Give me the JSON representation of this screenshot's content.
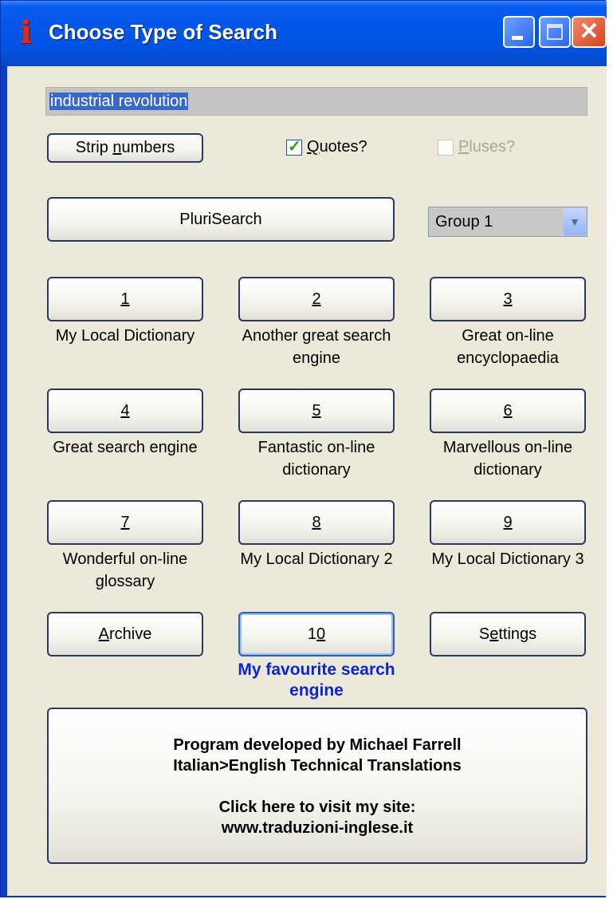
{
  "window": {
    "title": "Choose Type of Search",
    "icon": "i",
    "controls": {
      "minimize": "minimize-icon",
      "maximize": "maximize-icon",
      "close": "close-icon"
    }
  },
  "search": {
    "value": "industrial revolution"
  },
  "options": {
    "strip_label": "Strip numbers",
    "quotes_label": "Quotes?",
    "quotes_checked": true,
    "pluses_label": "Pluses?",
    "pluses_checked": false,
    "pluses_enabled": false
  },
  "plurisearch_label": "PluriSearch",
  "group_select": {
    "value": "Group 1"
  },
  "engines": [
    {
      "num": "1",
      "label": "My Local Dictionary"
    },
    {
      "num": "2",
      "label": "Another great search engine"
    },
    {
      "num": "3",
      "label": "Great on-line encyclopaedia"
    },
    {
      "num": "4",
      "label": "Great search engine"
    },
    {
      "num": "5",
      "label": "Fantastic on-line dictionary"
    },
    {
      "num": "6",
      "label": "Marvellous on-line dictionary"
    },
    {
      "num": "7",
      "label": "Wonderful on-line glossary"
    },
    {
      "num": "8",
      "label": "My Local Dictionary 2"
    },
    {
      "num": "9",
      "label": "My Local Dictionary 3"
    }
  ],
  "bottom_row": {
    "archive_label": "Archive",
    "ten_label": "10",
    "settings_label": "Settings",
    "favourite_label": "My favourite search engine"
  },
  "info": {
    "line1": "Program developed by Michael Farrell",
    "line2": "Italian>English Technical Translations",
    "line3": "Click here to visit my site:",
    "line4": "www.traduzioni-inglese.it"
  },
  "colors": {
    "titlebar": "#0054e3",
    "client_bg": "#ece9d8",
    "favourite_text": "#0b24d4",
    "check_mark": "#21a121"
  }
}
